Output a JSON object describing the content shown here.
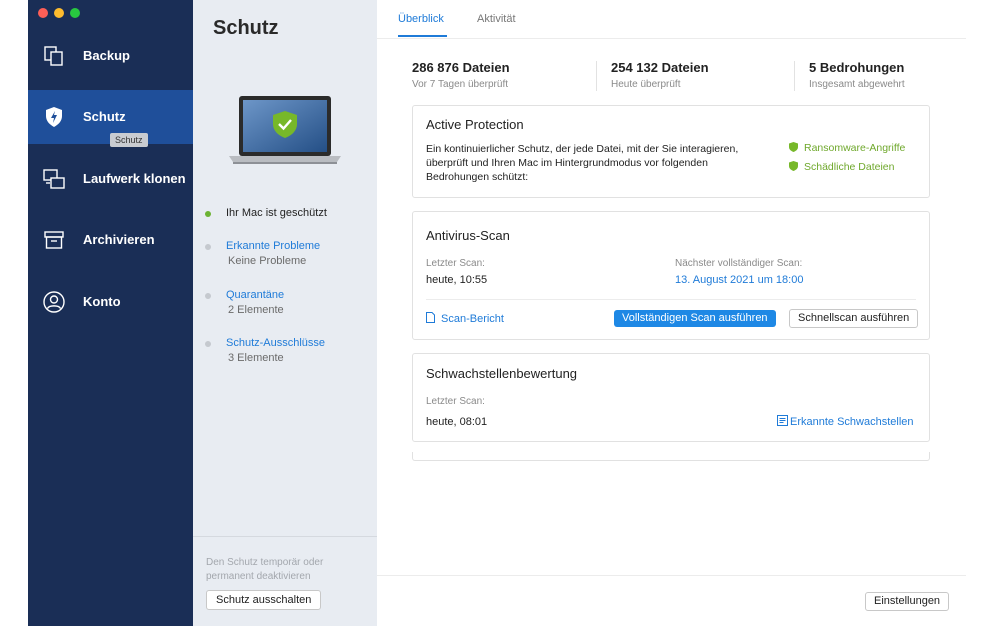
{
  "window": {
    "traffic_lights": [
      "#fe5f57",
      "#febc2e",
      "#28c840"
    ]
  },
  "sidebar": {
    "items": [
      {
        "label": "Backup",
        "icon": "backup-copy-icon"
      },
      {
        "label": "Schutz",
        "icon": "shield-icon",
        "active": true
      },
      {
        "label": "Laufwerk klonen",
        "icon": "clone-drive-icon"
      },
      {
        "label": "Archivieren",
        "icon": "archive-box-icon"
      },
      {
        "label": "Konto",
        "icon": "account-person-icon"
      }
    ],
    "tooltip": "Schutz"
  },
  "middle": {
    "title": "Schutz",
    "status": [
      {
        "title": "Ihr Mac ist geschützt",
        "sub": ""
      },
      {
        "title": "Erkannte Probleme",
        "sub": "Keine Probleme"
      },
      {
        "title": "Quarantäne",
        "sub": "2 Elemente"
      },
      {
        "title": "Schutz-Ausschlüsse",
        "sub": "3 Elemente"
      }
    ],
    "footer_text": "Den Schutz temporär oder permanent deaktivieren",
    "disable_button": "Schutz ausschalten"
  },
  "tabs": [
    {
      "label": "Überblick",
      "active": true
    },
    {
      "label": "Aktivität",
      "active": false
    }
  ],
  "stats": [
    {
      "value": "286 876 Dateien",
      "sub": "Vor 7 Tagen überprüft"
    },
    {
      "value": "254 132 Dateien",
      "sub": "Heute überprüft"
    },
    {
      "value": "5 Bedrohungen",
      "sub": "Insgesamt abgewehrt"
    }
  ],
  "active_protection": {
    "title": "Active Protection",
    "description": "Ein kontinuierlicher Schutz, der jede Datei, mit der Sie interagieren, überprüft und Ihren Mac im Hintergrundmodus vor folgenden Bedrohungen schützt:",
    "threats": [
      "Ransomware-Angriffe",
      "Schädliche Dateien"
    ]
  },
  "antivirus": {
    "title": "Antivirus-Scan",
    "last_scan_label": "Letzter Scan:",
    "last_scan_value": "heute, 10:55",
    "next_scan_label": "Nächster vollständiger Scan:",
    "next_scan_value": "13. August 2021 um 18:00",
    "report_link": "Scan-Bericht",
    "full_scan_button": "Vollständigen Scan ausführen",
    "quick_scan_button": "Schnellscan ausführen"
  },
  "vulnerability": {
    "title": "Schwachstellenbewertung",
    "last_scan_label": "Letzter Scan:",
    "last_scan_value": "heute, 08:01",
    "link": "Erkannte Schwachstellen"
  },
  "footer": {
    "settings_button": "Einstellungen"
  }
}
